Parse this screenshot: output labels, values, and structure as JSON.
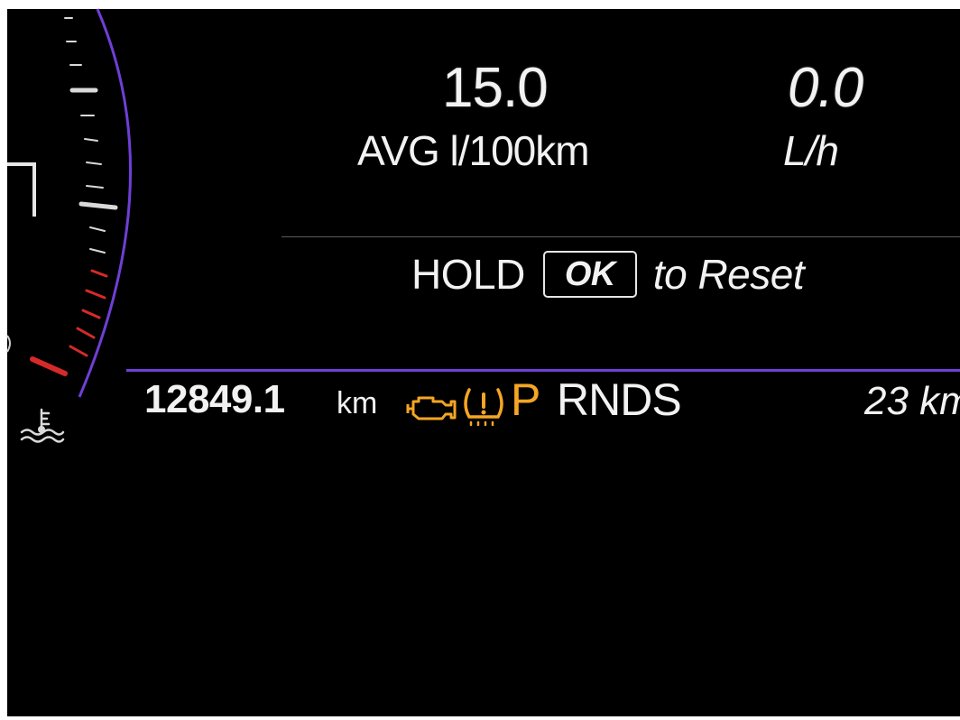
{
  "fuel": {
    "avg_value": "15.0",
    "avg_unit": "AVG l/100km",
    "rate_value": "0.0",
    "rate_unit": "L/h"
  },
  "reset": {
    "hold_text": "HOLD",
    "ok_key": "OK",
    "suffix_text": "to Reset"
  },
  "status_bar": {
    "odometer": "12849.1",
    "odometer_unit": "km",
    "gear_selected": "P",
    "gear_others": "RNDS",
    "range": "23 km"
  },
  "icons": {
    "engine_warning": "check-engine-icon",
    "tire_pressure": "tire-pressure-icon",
    "coolant_temp": "coolant-temperature-icon"
  },
  "colors": {
    "background": "#000000",
    "text": "#f2f2f2",
    "warning_amber": "#f5a623",
    "accent_purple": "#6f3fd6",
    "redline": "#d62a2a"
  }
}
